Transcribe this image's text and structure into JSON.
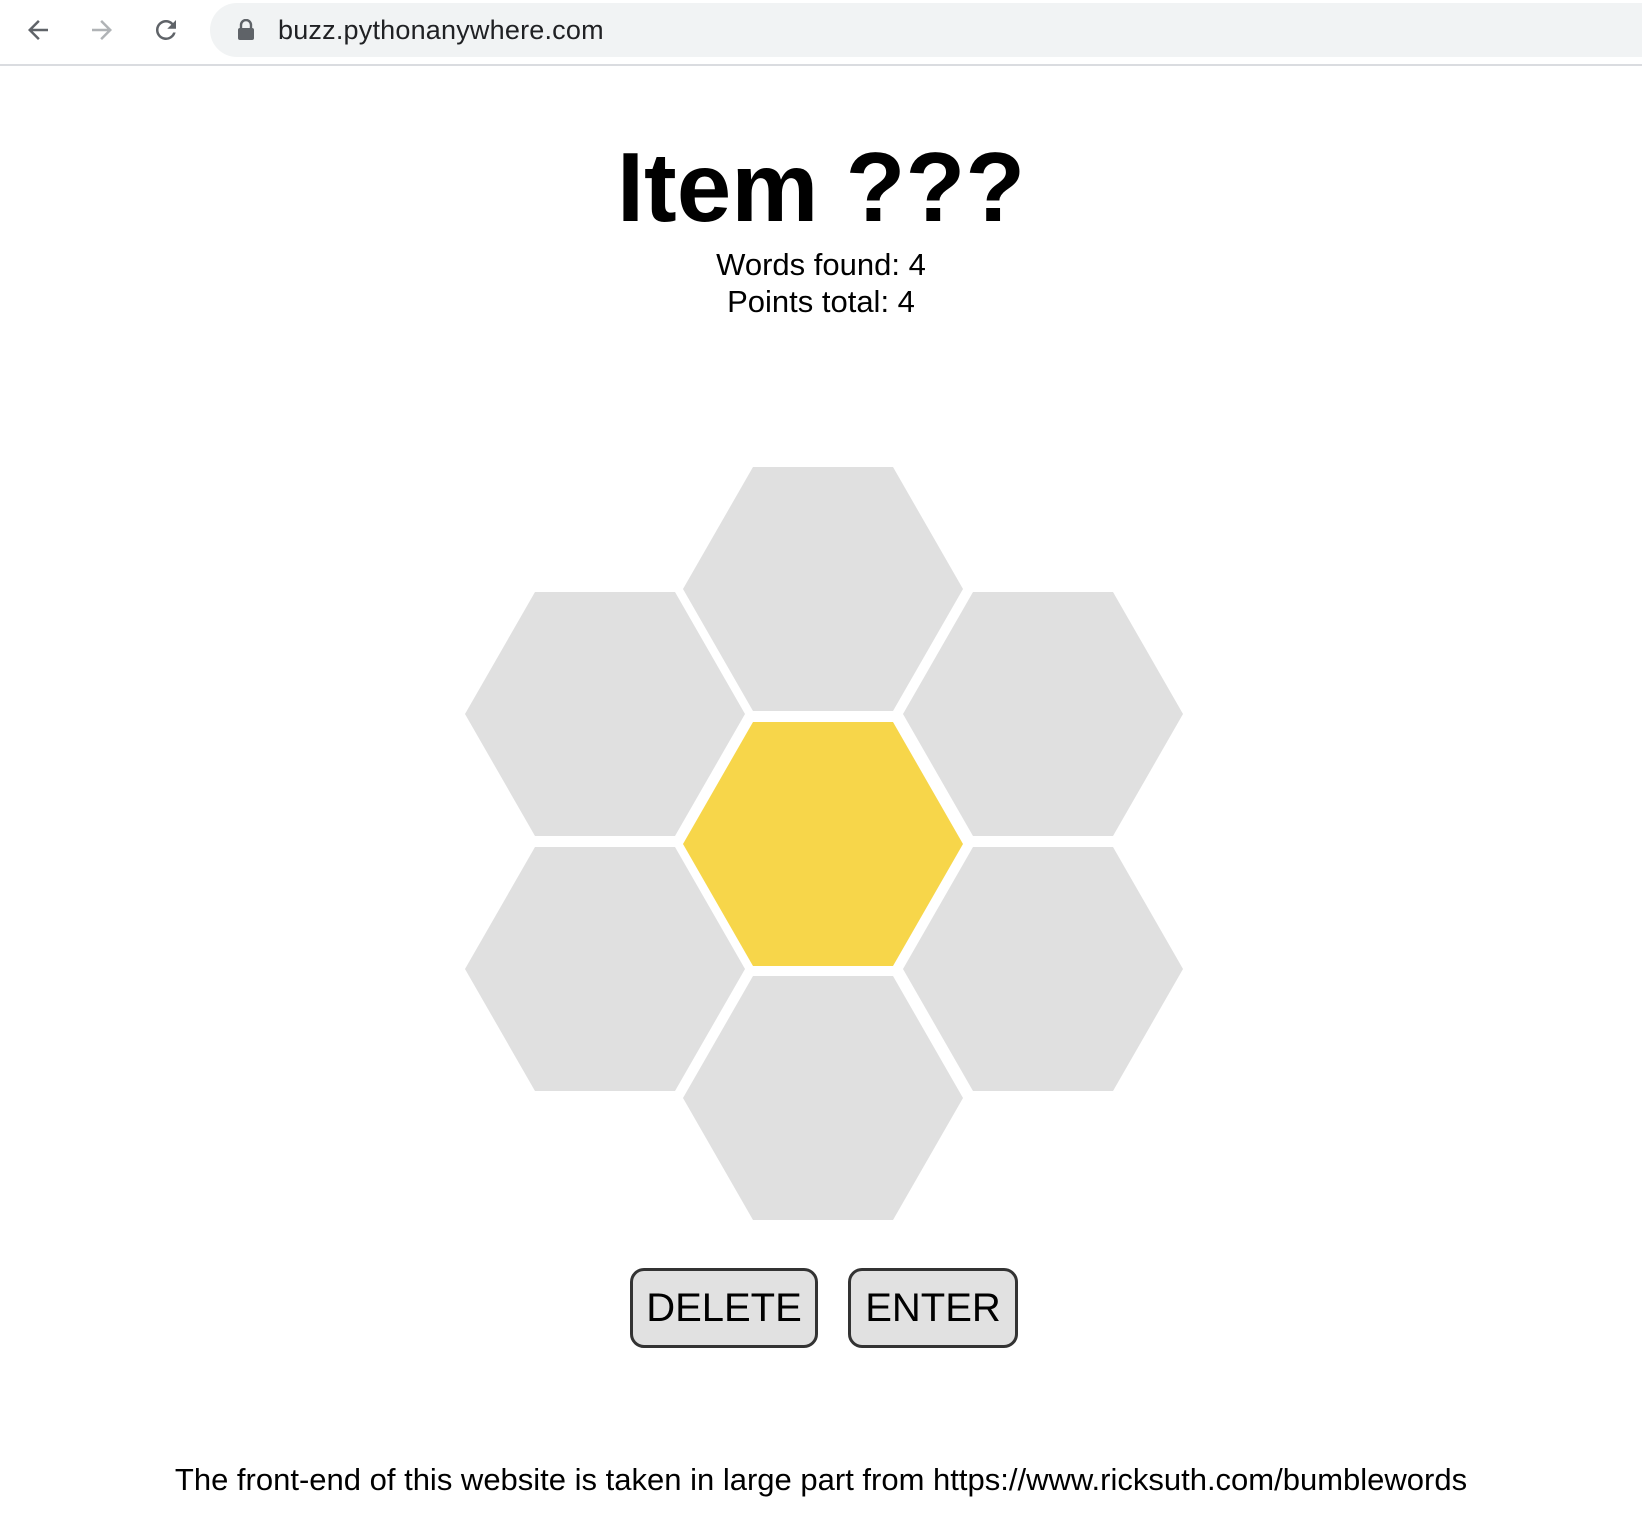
{
  "browser": {
    "url": "buzz.pythonanywhere.com",
    "back_icon": "arrow-left-icon",
    "forward_icon": "arrow-right-icon",
    "reload_icon": "reload-icon",
    "lock_icon": "lock-icon"
  },
  "header": {
    "title": "Item ???",
    "words_found": "Words found: 4",
    "points_total": "Points total: 4"
  },
  "hive": {
    "cells": [
      {
        "position": "center",
        "letter": "",
        "color": "#f7d64a"
      },
      {
        "position": "top",
        "letter": "",
        "color": "#e0e0e0"
      },
      {
        "position": "upper-left",
        "letter": "",
        "color": "#e0e0e0"
      },
      {
        "position": "upper-right",
        "letter": "",
        "color": "#e0e0e0"
      },
      {
        "position": "lower-left",
        "letter": "",
        "color": "#e0e0e0"
      },
      {
        "position": "lower-right",
        "letter": "",
        "color": "#e0e0e0"
      },
      {
        "position": "bottom",
        "letter": "",
        "color": "#e0e0e0"
      }
    ]
  },
  "controls": {
    "delete_label": "DELETE",
    "enter_label": "ENTER"
  },
  "footer": {
    "text": "The front-end of this website is taken in large part from https://www.ricksuth.com/bumblewords"
  },
  "colors": {
    "center_cell": "#f7d64a",
    "outer_cell": "#e0e0e0",
    "button_bg": "#e1e1e1"
  }
}
